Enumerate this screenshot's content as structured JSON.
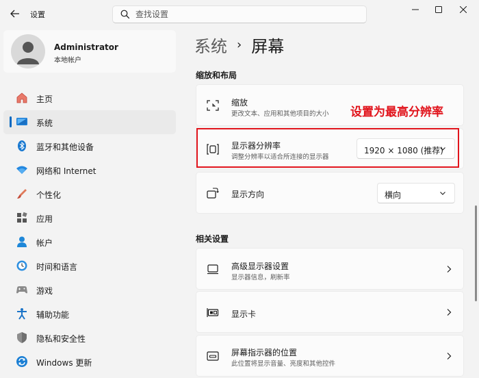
{
  "titlebar": {
    "app_title": "设置",
    "search_placeholder": "查找设置"
  },
  "profile": {
    "name": "Administrator",
    "account_type": "本地帐户"
  },
  "sidebar": {
    "items": [
      {
        "label": "主页",
        "icon": "home-icon"
      },
      {
        "label": "系统",
        "icon": "system-icon",
        "active": true
      },
      {
        "label": "蓝牙和其他设备",
        "icon": "bluetooth-icon"
      },
      {
        "label": "网络和 Internet",
        "icon": "wifi-icon"
      },
      {
        "label": "个性化",
        "icon": "brush-icon"
      },
      {
        "label": "应用",
        "icon": "apps-icon"
      },
      {
        "label": "帐户",
        "icon": "account-icon"
      },
      {
        "label": "时间和语言",
        "icon": "clock-globe-icon"
      },
      {
        "label": "游戏",
        "icon": "gamepad-icon"
      },
      {
        "label": "辅助功能",
        "icon": "accessibility-icon"
      },
      {
        "label": "隐私和安全性",
        "icon": "shield-icon"
      },
      {
        "label": "Windows 更新",
        "icon": "update-icon"
      }
    ]
  },
  "breadcrumb": {
    "parent": "系统",
    "separator": "›",
    "current": "屏幕"
  },
  "scale_layout": {
    "heading": "缩放和布局",
    "scale": {
      "title": "缩放",
      "subtitle": "更改文本、应用和其他项目的大小"
    },
    "resolution": {
      "title": "显示器分辨率",
      "subtitle": "调整分辨率以适合所连接的显示器",
      "value": "1920 × 1080 (推荐)"
    },
    "orientation": {
      "title": "显示方向",
      "value": "横向"
    }
  },
  "related": {
    "heading": "相关设置",
    "items": [
      {
        "title": "高级显示器设置",
        "subtitle": "显示器信息，刷新率"
      },
      {
        "title": "显示卡",
        "subtitle": ""
      },
      {
        "title": "屏幕指示器的位置",
        "subtitle": "此位置将显示音量、亮度和其他控件"
      }
    ]
  },
  "annotation": {
    "text": "设置为最高分辨率",
    "color": "#e1141c"
  },
  "colors": {
    "accent": "#0067c0",
    "annotation": "#e1141c"
  }
}
